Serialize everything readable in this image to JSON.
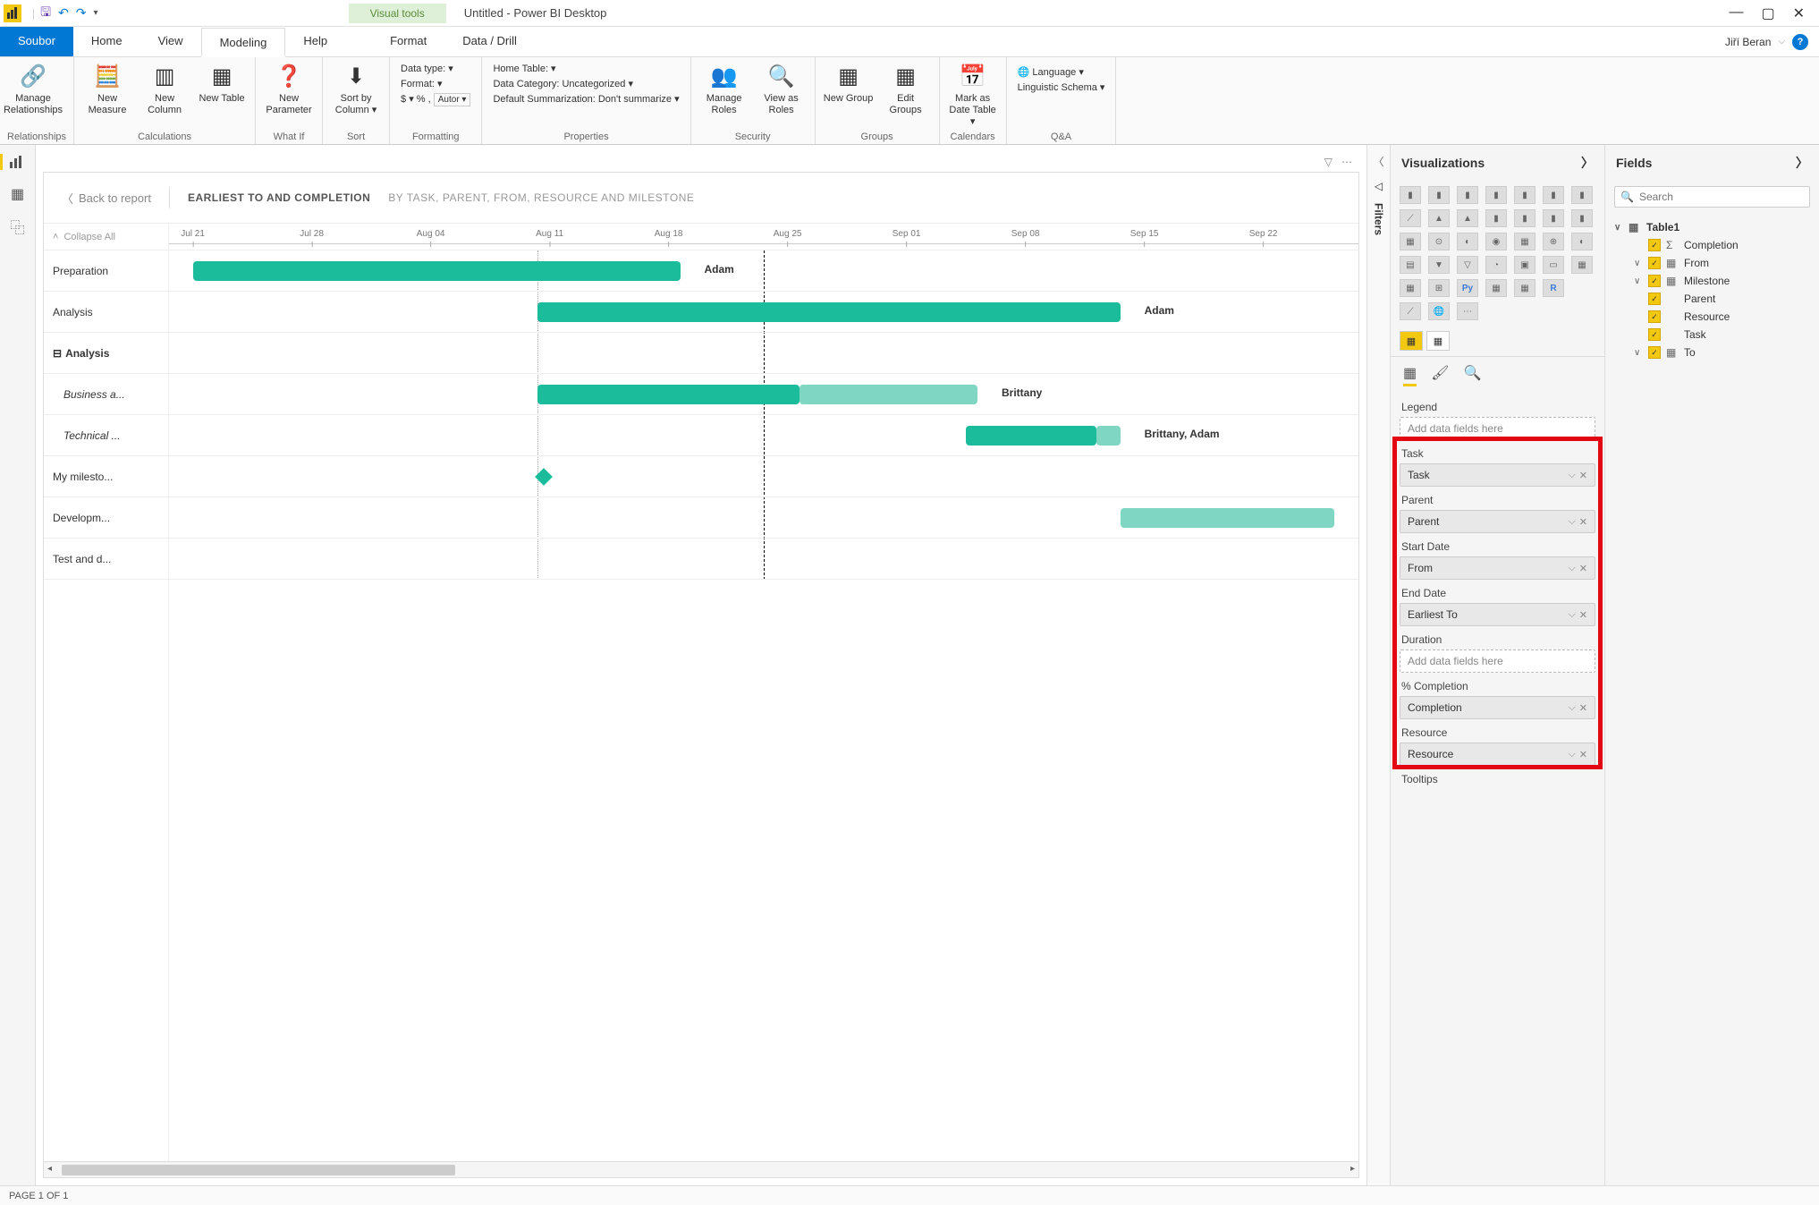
{
  "titlebar": {
    "visual_tools": "Visual tools",
    "title": "Untitled - Power BI Desktop"
  },
  "menu": {
    "soubor": "Soubor",
    "home": "Home",
    "view": "View",
    "modeling": "Modeling",
    "help": "Help",
    "format": "Format",
    "datadrill": "Data / Drill",
    "user": "Jiří Beran"
  },
  "ribbon": {
    "relationships": {
      "manage": "Manage Relationships",
      "group": "Relationships"
    },
    "calculations": {
      "measure": "New Measure",
      "column": "New Column",
      "table": "New Table",
      "group": "Calculations"
    },
    "whatif": {
      "param": "New Parameter",
      "group": "What If"
    },
    "sort": {
      "sort": "Sort by Column ▾",
      "group": "Sort"
    },
    "formatting": {
      "datatype": "Data type: ▾",
      "format": "Format: ▾",
      "currency": "$ ▾ % , ",
      "auto": "Autor ▾",
      "group": "Formatting"
    },
    "properties": {
      "hometable": "Home Table: ▾",
      "category": "Data Category: Uncategorized ▾",
      "summarization": "Default Summarization: Don't summarize ▾",
      "group": "Properties"
    },
    "security": {
      "manage": "Manage Roles",
      "viewas": "View as Roles",
      "group": "Security"
    },
    "groups": {
      "new": "New Group",
      "edit": "Edit Groups",
      "group": "Groups"
    },
    "calendars": {
      "mark": "Mark as Date Table ▾",
      "group": "Calendars"
    },
    "qa": {
      "lang": "Language ▾",
      "schema": "Linguistic Schema ▾",
      "group": "Q&A"
    }
  },
  "report": {
    "back": "Back to report",
    "title": "EARLIEST TO AND COMPLETION",
    "subtitle": "BY TASK, PARENT, FROM, RESOURCE AND MILESTONE",
    "collapse": "Collapse All"
  },
  "timeline": [
    "Jul 21",
    "Jul 28",
    "Aug 04",
    "Aug 11",
    "Aug 18",
    "Aug 25",
    "Sep 01",
    "Sep 08",
    "Sep 15",
    "Sep 22"
  ],
  "tasks": [
    {
      "name": "Preparation",
      "label": "Adam",
      "type": "task"
    },
    {
      "name": "Analysis",
      "label": "Adam",
      "type": "task"
    },
    {
      "name": "Analysis",
      "label": "",
      "type": "group"
    },
    {
      "name": "Business a...",
      "label": "Brittany",
      "type": "child"
    },
    {
      "name": "Technical ...",
      "label": "Brittany, Adam",
      "type": "child"
    },
    {
      "name": "My milesto...",
      "label": "",
      "type": "milestone"
    },
    {
      "name": "Developm...",
      "label": "",
      "type": "task"
    },
    {
      "name": "Test and d...",
      "label": "",
      "type": "task"
    }
  ],
  "filters_label": "Filters",
  "viz_panel": {
    "title": "Visualizations",
    "legend": "Legend",
    "add_placeholder": "Add data fields here",
    "wells": [
      {
        "label": "Task",
        "chip": "Task"
      },
      {
        "label": "Parent",
        "chip": "Parent"
      },
      {
        "label": "Start Date",
        "chip": "From"
      },
      {
        "label": "End Date",
        "chip": "Earliest To"
      },
      {
        "label": "Duration",
        "chip": null
      },
      {
        "label": "% Completion",
        "chip": "Completion"
      },
      {
        "label": "Resource",
        "chip": "Resource"
      }
    ],
    "tooltips": "Tooltips"
  },
  "fields_panel": {
    "title": "Fields",
    "search_placeholder": "Search",
    "table": "Table1",
    "fields": [
      {
        "name": "Completion",
        "icon": "Σ",
        "exp": ""
      },
      {
        "name": "From",
        "icon": "▦",
        "exp": "∨"
      },
      {
        "name": "Milestone",
        "icon": "▦",
        "exp": "∨"
      },
      {
        "name": "Parent",
        "icon": "",
        "exp": ""
      },
      {
        "name": "Resource",
        "icon": "",
        "exp": ""
      },
      {
        "name": "Task",
        "icon": "",
        "exp": ""
      },
      {
        "name": "To",
        "icon": "▦",
        "exp": "∨"
      }
    ]
  },
  "status": "PAGE 1 OF 1",
  "chart_data": {
    "type": "bar",
    "title": "EARLIEST TO AND COMPLETION",
    "subtitle": "BY TASK, PARENT, FROM, RESOURCE AND MILESTONE",
    "x_axis": {
      "type": "date",
      "ticks": [
        "Jul 21",
        "Jul 28",
        "Aug 04",
        "Aug 11",
        "Aug 18",
        "Aug 25",
        "Sep 01",
        "Sep 08",
        "Sep 15",
        "Sep 22"
      ]
    },
    "today_marker": "Aug 23",
    "rows": [
      {
        "task": "Preparation",
        "resource": "Adam",
        "start": "Jul 21",
        "end": "Aug 18",
        "completion": 1.0
      },
      {
        "task": "Analysis",
        "resource": "Adam",
        "start": "Aug 10",
        "end": "Sep 13",
        "completion": 1.0
      },
      {
        "task": "Analysis (group)",
        "rows": [
          {
            "task": "Business a...",
            "resource": "Brittany",
            "start": "Aug 10",
            "end": "Sep 05",
            "completion": 0.55
          },
          {
            "task": "Technical ...",
            "resource": "Brittany, Adam",
            "start": "Sep 04",
            "end": "Sep 13",
            "completion": 0.85
          }
        ]
      },
      {
        "task": "My milesto...",
        "type": "milestone",
        "date": "Aug 11"
      },
      {
        "task": "Developm...",
        "resource": "",
        "start": "Sep 13",
        "end": "Sep 28+",
        "completion": 0.0
      },
      {
        "task": "Test and d...",
        "resource": "",
        "start": null,
        "end": null
      }
    ]
  }
}
